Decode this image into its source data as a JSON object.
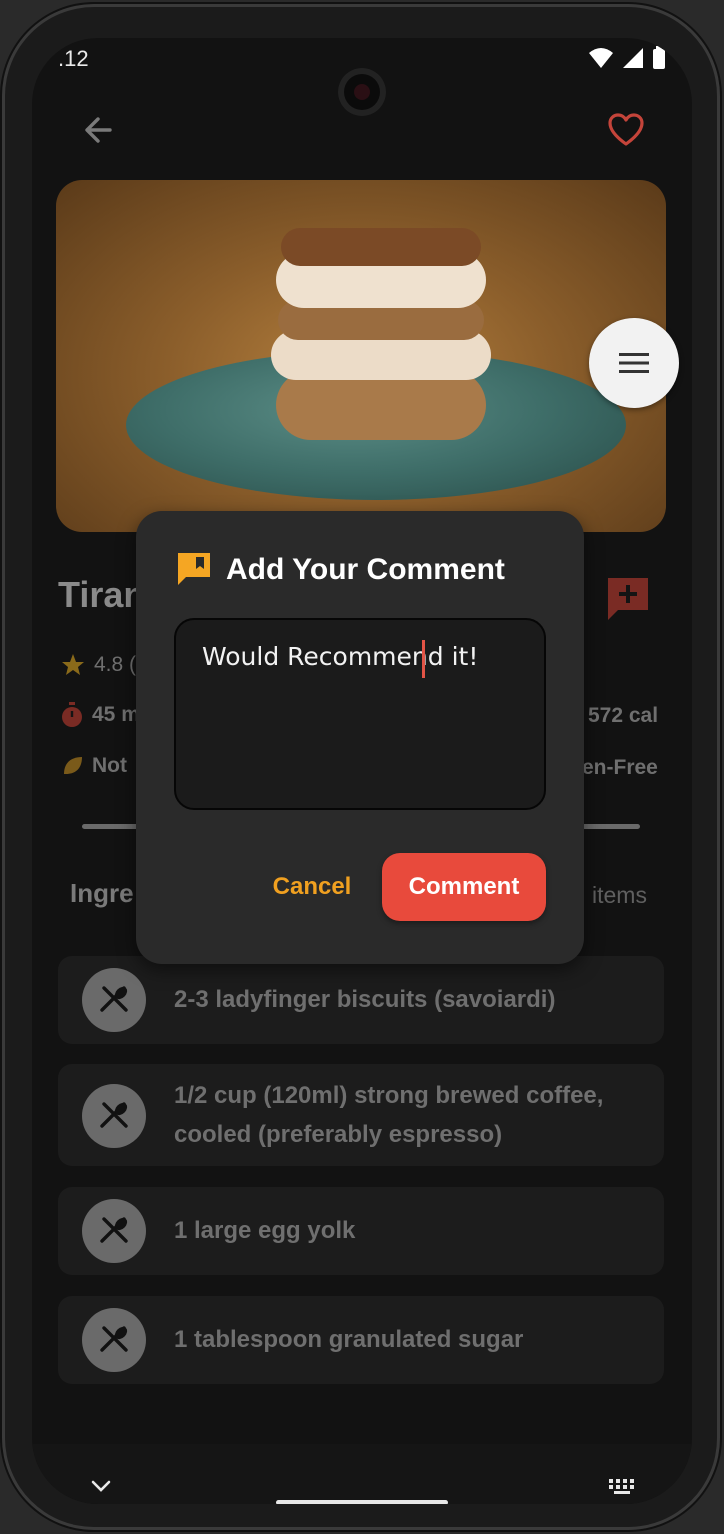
{
  "status_bar": {
    "time": ".12"
  },
  "recipe": {
    "title": "Tiran",
    "rating": "4.8 (",
    "time": "45 m",
    "calories": "572 cal",
    "diet_left": "Not",
    "diet_right": "en-Free"
  },
  "ingredients": {
    "header": "Ingre",
    "count": "items",
    "items": [
      {
        "text": "2-3 ladyfinger biscuits (savoiardi)"
      },
      {
        "text": "1/2 cup (120ml) strong brewed coffee, cooled (preferably espresso)"
      },
      {
        "text": "1 large egg yolk"
      },
      {
        "text": "1 tablespoon granulated sugar"
      }
    ]
  },
  "dialog": {
    "title": "Add Your Comment",
    "input_value": "Would Recommend it!",
    "cancel_label": "Cancel",
    "submit_label": "Comment"
  },
  "icons": {
    "back": "arrow-left-icon",
    "favorite": "heart-outline-icon",
    "menu": "menu-icon",
    "add_comment": "add-comment-icon",
    "dialog": "comment-flag-icon",
    "ingredient": "utensils-icon",
    "nav_down": "chevron-down-icon",
    "keyboard": "keyboard-icon"
  },
  "colors": {
    "accent": "#e84a3c",
    "cancel": "#f0a020",
    "dialog_bg": "#2a2a2a",
    "dialog_icon": "#f5a623",
    "heart": "#c4443a",
    "add_comment": "#7a2b24"
  }
}
